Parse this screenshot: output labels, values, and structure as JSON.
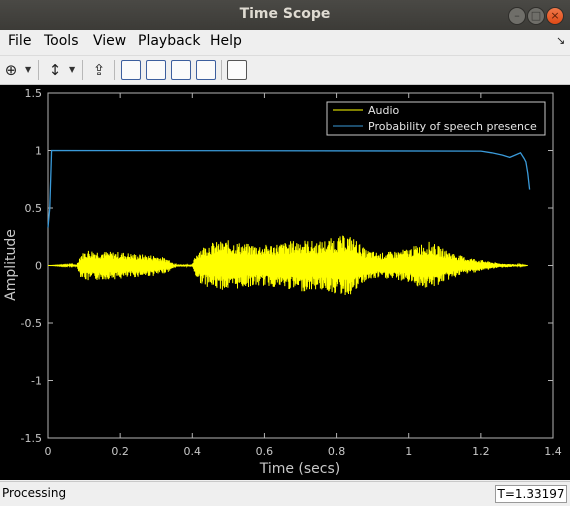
{
  "window": {
    "title": "Time Scope"
  },
  "menu": [
    "File",
    "Tools",
    "View",
    "Playback",
    "Help"
  ],
  "toolbar": {
    "icons": [
      "zoom-in-icon",
      "autoscale-icon",
      "highlight-simulink-icon",
      "cursor-measurements-icon",
      "signal-statistics-icon",
      "peak-finder-icon",
      "bilevel-measurements-icon",
      "layout-icon"
    ]
  },
  "chart_data": {
    "type": "line",
    "xlabel": "Time (secs)",
    "ylabel": "Amplitude",
    "xlim": [
      0,
      1.4
    ],
    "ylim": [
      -1.5,
      1.5
    ],
    "xticks": [
      "0",
      "0.2",
      "0.4",
      "0.6",
      "0.8",
      "1",
      "1.2",
      "1.4"
    ],
    "yticks": [
      "1.5",
      "1",
      "0.5",
      "0",
      "-0.5",
      "-1",
      "-1.5"
    ],
    "grid": false,
    "legend_position": "top-right",
    "series": [
      {
        "name": "Audio",
        "color": "#ffff00",
        "envelope": {
          "t": [
            0,
            0.08,
            0.09,
            0.11,
            0.14,
            0.17,
            0.2,
            0.25,
            0.3,
            0.34,
            0.35,
            0.4,
            0.41,
            0.42,
            0.45,
            0.5,
            0.55,
            0.6,
            0.65,
            0.7,
            0.75,
            0.8,
            0.83,
            0.85,
            0.88,
            0.92,
            0.97,
            1.0,
            1.03,
            1.06,
            1.1,
            1.15,
            1.2,
            1.25,
            1.3,
            1.33
          ],
          "amp": [
            0,
            0.01,
            0.1,
            0.14,
            0.13,
            0.12,
            0.12,
            0.1,
            0.09,
            0.05,
            0.01,
            0.01,
            0.1,
            0.15,
            0.2,
            0.22,
            0.19,
            0.18,
            0.2,
            0.23,
            0.21,
            0.25,
            0.27,
            0.24,
            0.14,
            0.11,
            0.13,
            0.15,
            0.19,
            0.21,
            0.14,
            0.08,
            0.05,
            0.02,
            0.01,
            0
          ]
        }
      },
      {
        "name": "Probability of speech presence",
        "color": "#3a9ad9",
        "points": [
          [
            0,
            0.33
          ],
          [
            0.005,
            0.5
          ],
          [
            0.01,
            1.0
          ],
          [
            1.2,
            0.995
          ],
          [
            1.23,
            0.98
          ],
          [
            1.26,
            0.96
          ],
          [
            1.28,
            0.94
          ],
          [
            1.295,
            0.96
          ],
          [
            1.31,
            0.98
          ],
          [
            1.32,
            0.93
          ],
          [
            1.325,
            0.9
          ],
          [
            1.33,
            0.8
          ],
          [
            1.335,
            0.66
          ]
        ]
      }
    ]
  },
  "status": {
    "text": "Processing",
    "time": "T=1.33197"
  }
}
